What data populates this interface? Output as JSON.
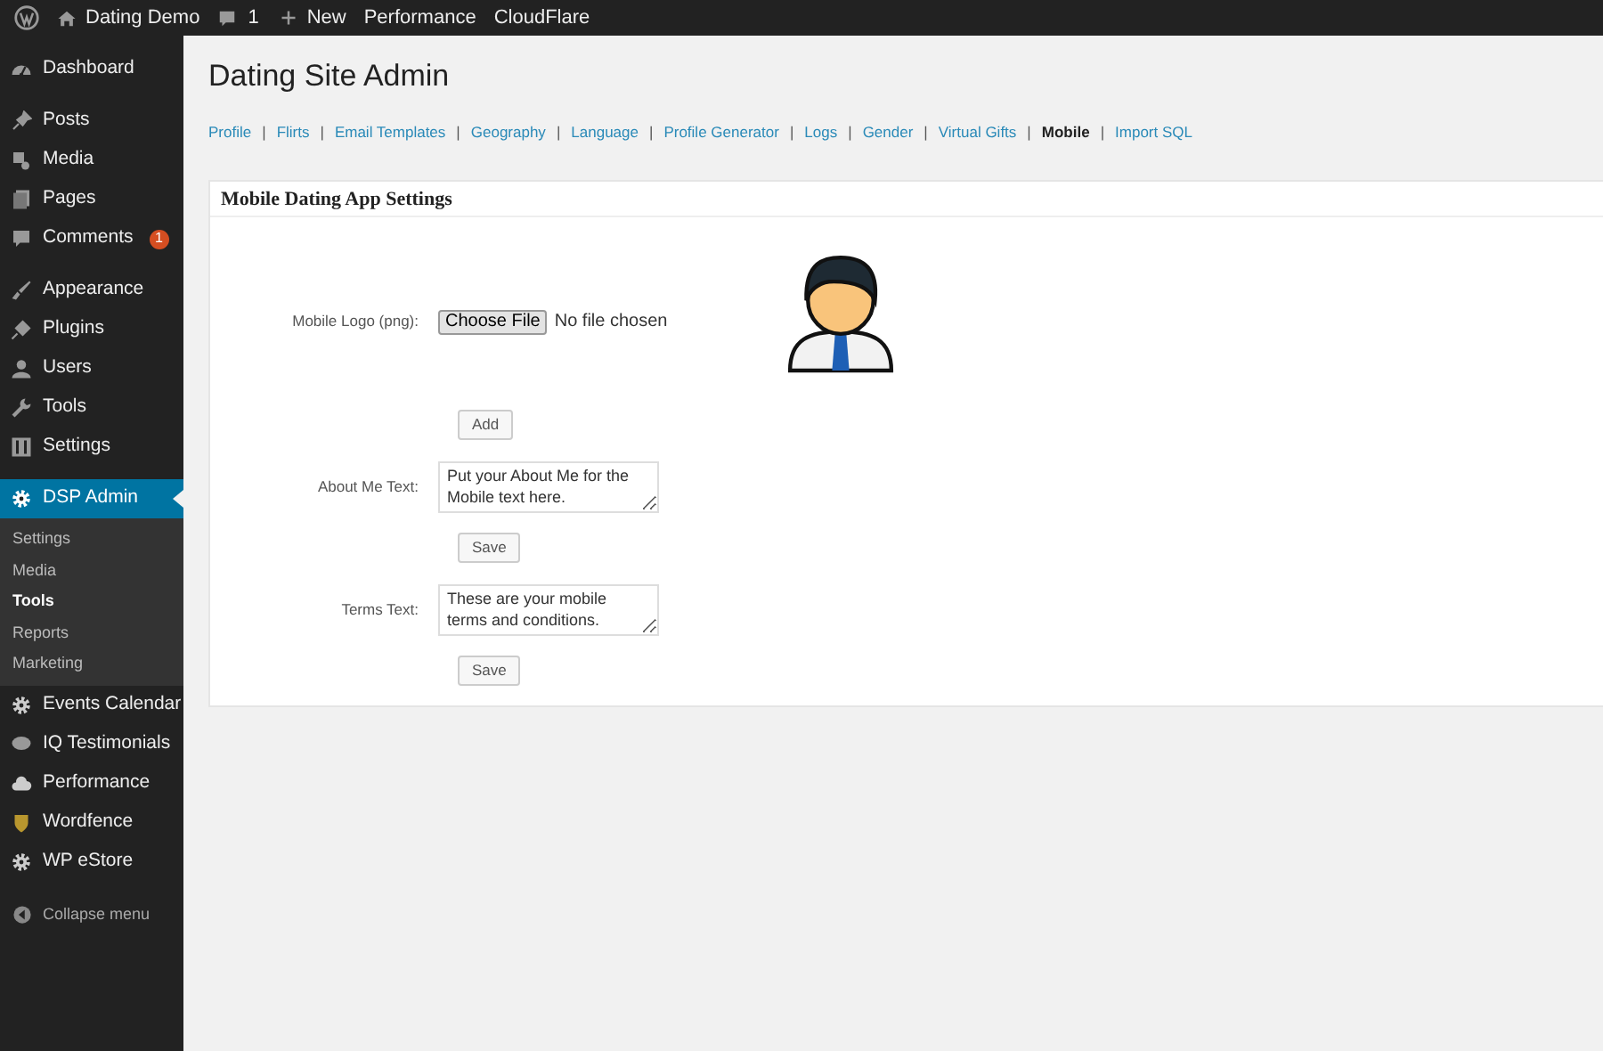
{
  "admin_bar": {
    "site": "Dating Demo",
    "comments": "1",
    "new": "New",
    "links": [
      "Performance",
      "CloudFlare"
    ]
  },
  "sidebar": {
    "sections": [
      [
        {
          "label": "Dashboard",
          "selected": false
        }
      ],
      [
        {
          "label": "Posts",
          "selected": false
        },
        {
          "label": "Media",
          "selected": false
        },
        {
          "label": "Pages",
          "selected": false
        },
        {
          "label": "Comments",
          "selected": false,
          "badge": "1"
        }
      ],
      [
        {
          "label": "Appearance",
          "selected": false
        },
        {
          "label": "Plugins",
          "selected": false
        },
        {
          "label": "Users",
          "selected": false
        },
        {
          "label": "Tools",
          "selected": false
        },
        {
          "label": "Settings",
          "selected": false
        }
      ],
      [
        {
          "label": "DSP Admin",
          "selected": true,
          "children": [
            {
              "label": "Settings",
              "selected": false
            },
            {
              "label": "Media",
              "selected": false
            },
            {
              "label": "Tools",
              "selected": true
            },
            {
              "label": "Reports",
              "selected": false
            },
            {
              "label": "Marketing",
              "selected": false
            }
          ]
        },
        {
          "label": "Events Calendar",
          "selected": false
        },
        {
          "label": "IQ Testimonials",
          "selected": false
        },
        {
          "label": "Performance",
          "selected": false
        },
        {
          "label": "Wordfence",
          "selected": false
        },
        {
          "label": "WP eStore",
          "selected": false
        }
      ]
    ],
    "collapse": "Collapse menu"
  },
  "page_title": "Dating Site Admin",
  "nav": [
    {
      "label": "Profile",
      "selected": false,
      "separator": "|"
    },
    {
      "label": "Flirts",
      "selected": false,
      "separator": "|"
    },
    {
      "label": "Email Templates",
      "selected": false,
      "separator": "|"
    },
    {
      "label": "Geography",
      "selected": false,
      "separator": "|"
    },
    {
      "label": "Language",
      "selected": false,
      "separator": "|"
    },
    {
      "label": "Profile Generator",
      "selected": false,
      "separator": "|"
    },
    {
      "label": "Logs",
      "selected": false,
      "separator": "|"
    },
    {
      "label": "Gender",
      "selected": false,
      "separator": "|"
    },
    {
      "label": "Virtual Gifts",
      "selected": false,
      "separator": "|"
    },
    {
      "label": "Mobile",
      "selected": true,
      "separator": "|"
    },
    {
      "label": "Import SQL",
      "selected": false
    }
  ],
  "panel": {
    "title": "Mobile Dating App Settings",
    "logo": {
      "label": "Mobile Logo (png):",
      "button": "Choose File",
      "status": "No file chosen",
      "add": "Add"
    },
    "about": {
      "label": "About Me Text:",
      "value": "Put your About Me for the Mobile text here.",
      "save": "Save"
    },
    "terms": {
      "label": "Terms Text:",
      "value": "These are your mobile terms and conditions.",
      "save": "Save"
    }
  }
}
